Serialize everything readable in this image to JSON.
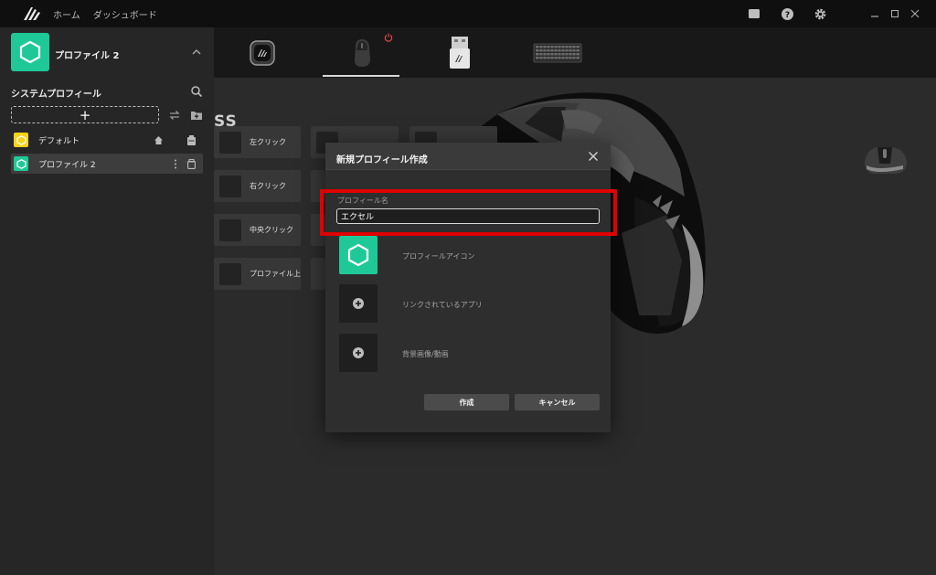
{
  "titlebar": {
    "nav": [
      "ホーム",
      "ダッシュボード"
    ]
  },
  "sidebar": {
    "current_profile": "プロファイル 2",
    "section_title": "システムプロフィール",
    "add_symbol": "+",
    "profiles": [
      {
        "label": "デフォルト",
        "color": "#f5d31a"
      },
      {
        "label": "プロファイル 2",
        "color": "#1fc997"
      }
    ]
  },
  "main": {
    "partial_title": "SS",
    "keys": [
      {
        "label": "左クリック"
      },
      {
        "label": "右クリック"
      },
      {
        "label": "中央クリック"
      },
      {
        "label": "プロファイル上"
      }
    ]
  },
  "modal": {
    "title": "新規プロフィール作成",
    "field_label": "プロフィール名",
    "name_value": "エクセル",
    "options": [
      "プロフィールアイコン",
      "リンクされているアプリ",
      "背景画像/動画"
    ],
    "create_label": "作成",
    "cancel_label": "キャンセル"
  },
  "colors": {
    "accent": "#1fc997",
    "default_profile": "#f5d31a",
    "highlight": "#e00000"
  }
}
